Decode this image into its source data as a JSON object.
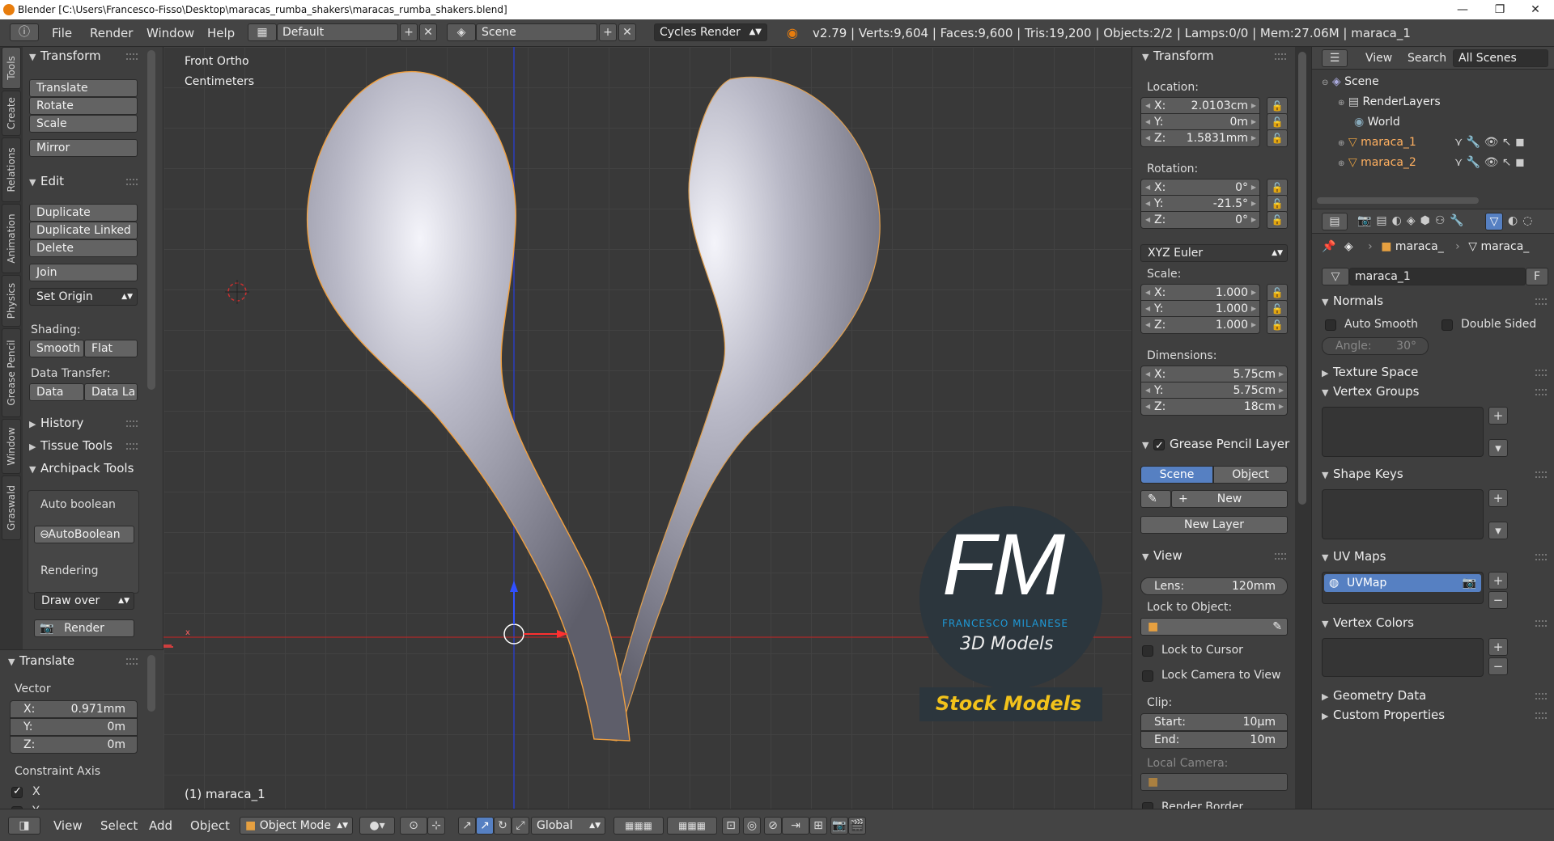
{
  "window": {
    "title": "Blender [C:\\Users\\Francesco-Fisso\\Desktop\\maracas_rumba_shakers\\maracas_rumba_shakers.blend]",
    "controls": [
      "—",
      "❐",
      "✕"
    ]
  },
  "topbar": {
    "menus": [
      "File",
      "Render",
      "Window",
      "Help"
    ],
    "screen_layout": "Default",
    "scene": "Scene",
    "render_engine": "Cycles Render",
    "stats": "v2.79 | Verts:9,604 | Faces:9,600 | Tris:19,200 | Objects:2/2 | Lamps:0/0 | Mem:27.06M | maraca_1"
  },
  "vertical_tabs": [
    "Tools",
    "Create",
    "Relations",
    "Animation",
    "Physics",
    "Grease Pencil",
    "Window",
    "Graswald"
  ],
  "toolshelf": {
    "transform": {
      "title": "Transform",
      "buttons": [
        "Translate",
        "Rotate",
        "Scale",
        "Mirror"
      ]
    },
    "edit": {
      "title": "Edit",
      "buttons": [
        "Duplicate",
        "Duplicate Linked",
        "Delete",
        "Join"
      ],
      "set_origin": "Set Origin",
      "shading_label": "Shading:",
      "smooth": "Smooth",
      "flat": "Flat",
      "data_transfer_label": "Data Transfer:",
      "data": "Data",
      "data_la": "Data La"
    },
    "history": "History",
    "tissue": "Tissue Tools",
    "archipack": "Archipack Tools",
    "auto_boolean_label": "Auto boolean",
    "auto_boolean_btn": "AutoBoolean",
    "rendering_label": "Rendering",
    "draw_over": "Draw over",
    "render_btn": "Render"
  },
  "redo_panel": {
    "title": "Translate",
    "vector_label": "Vector",
    "x_label": "X:",
    "x": "0.971mm",
    "y_label": "Y:",
    "y": "0m",
    "z_label": "Z:",
    "z": "0m",
    "constraint_label": "Constraint Axis",
    "cx": "X",
    "cy": "Y"
  },
  "viewport": {
    "view_name": "Front Ortho",
    "units": "Centimeters",
    "object_label": "(1) maraca_1",
    "axis_x": "x",
    "axis_z": "z",
    "watermark": {
      "initials": "FM",
      "name": "FRANCESCO MILANESE",
      "sub": "3D Models",
      "banner": "Stock Models"
    }
  },
  "npanel": {
    "transform_title": "Transform",
    "location_label": "Location:",
    "loc": [
      {
        "k": "X:",
        "v": "2.0103cm"
      },
      {
        "k": "Y:",
        "v": "0m"
      },
      {
        "k": "Z:",
        "v": "1.5831mm"
      }
    ],
    "rotation_label": "Rotation:",
    "rot": [
      {
        "k": "X:",
        "v": "0°"
      },
      {
        "k": "Y:",
        "v": "-21.5°"
      },
      {
        "k": "Z:",
        "v": "0°"
      }
    ],
    "rotation_mode": "XYZ Euler",
    "scale_label": "Scale:",
    "scale": [
      {
        "k": "X:",
        "v": "1.000"
      },
      {
        "k": "Y:",
        "v": "1.000"
      },
      {
        "k": "Z:",
        "v": "1.000"
      }
    ],
    "dimensions_label": "Dimensions:",
    "dim": [
      {
        "k": "X:",
        "v": "5.75cm"
      },
      {
        "k": "Y:",
        "v": "5.75cm"
      },
      {
        "k": "Z:",
        "v": "18cm"
      }
    ],
    "grease_pencil_title": "Grease Pencil Layer",
    "gp_scene": "Scene",
    "gp_object": "Object",
    "gp_new": "New",
    "gp_new_layer": "New Layer",
    "view_title": "View",
    "lens_label": "Lens:",
    "lens": "120mm",
    "lock_to_object_label": "Lock to Object:",
    "lock_to_cursor": "Lock to Cursor",
    "lock_camera": "Lock Camera to View",
    "clip_label": "Clip:",
    "clip_start_label": "Start:",
    "clip_start": "10µm",
    "clip_end_label": "End:",
    "clip_end": "10m",
    "local_camera_label": "Local Camera:",
    "render_border": "Render Border"
  },
  "outliner": {
    "view": "View",
    "search": "Search",
    "all_scenes": "All Scenes",
    "items": [
      "Scene",
      "RenderLayers",
      "World",
      "maraca_1",
      "maraca_2"
    ]
  },
  "properties": {
    "breadcrumb_obj": "maraca_",
    "breadcrumb_mesh": "maraca_",
    "mesh_name": "maraca_1",
    "fake_user": "F",
    "normals": "Normals",
    "auto_smooth": "Auto Smooth",
    "double_sided": "Double Sided",
    "angle_label": "Angle:",
    "angle": "30°",
    "texture_space": "Texture Space",
    "vertex_groups": "Vertex Groups",
    "shape_keys": "Shape Keys",
    "uv_maps": "UV Maps",
    "uv_map_item": "UVMap",
    "vertex_colors": "Vertex Colors",
    "geometry_data": "Geometry Data",
    "custom_properties": "Custom Properties"
  },
  "bottombar": {
    "menus": [
      "View",
      "Select",
      "Add",
      "Object"
    ],
    "mode": "Object Mode",
    "orientation": "Global"
  },
  "colors": {
    "accent": "#5680c2",
    "selection_outline": "#e8a040",
    "watermark_blue": "#1e9ad8",
    "banner_yellow": "#f2c21b"
  }
}
